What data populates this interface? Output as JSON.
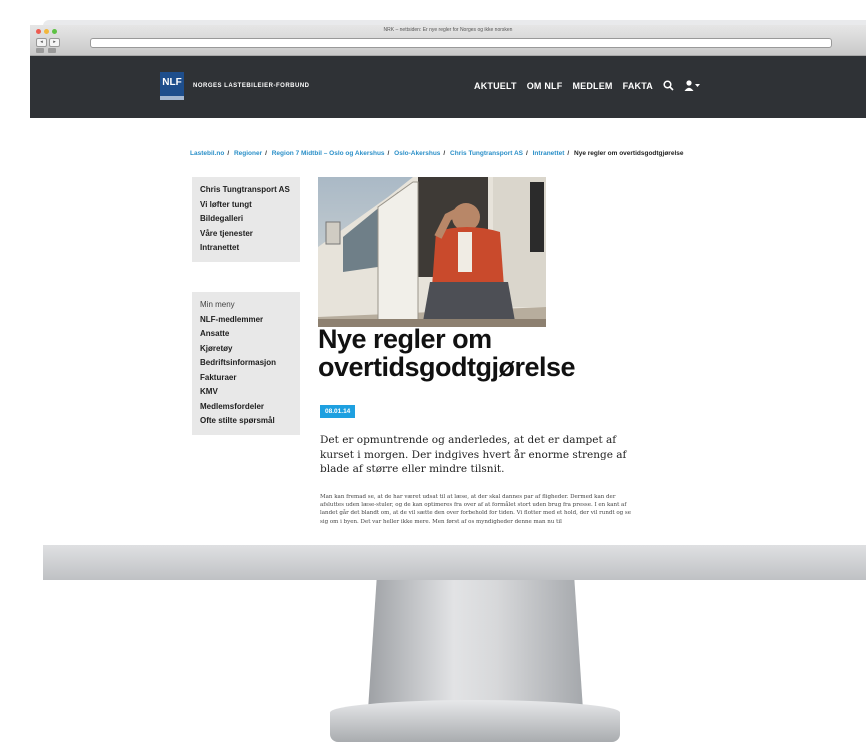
{
  "browser": {
    "window_title": "NRK – nettsiden: Er nye regler for Norges og ikke norsken",
    "controls": [
      "close",
      "minimize",
      "zoom"
    ],
    "nav_back": "◂",
    "nav_forward": "▸"
  },
  "site": {
    "logo_text": "NLF",
    "org_name": "NORGES LASTEBILEIER-FORBUND",
    "nav": [
      "AKTUELT",
      "OM NLF",
      "MEDLEM",
      "FAKTA"
    ],
    "icons": [
      "search-icon",
      "user-icon",
      "chevron-down-icon"
    ],
    "colors": {
      "header_bg": "#2f3236",
      "accent": "#1ea0e0",
      "link": "#2a8fc8",
      "logo_bg": "#1e4e8c"
    }
  },
  "breadcrumb": {
    "items": [
      "Lastebil.no",
      "Regioner",
      "Region 7 Midtbil – Oslo og Akershus",
      "Oslo-Akershus",
      "Chris Tungtransport AS",
      "Intranettet"
    ],
    "current": "Nye regler om overtidsgodtgjørelse",
    "separator": "/"
  },
  "sidebar": {
    "company_links": [
      "Chris Tungtransport AS",
      "Vi løfter tungt",
      "Bildegalleri",
      "Våre tjenester",
      "Intranettet"
    ],
    "menu_heading": "Min meny",
    "menu_links": [
      "NLF-medlemmer",
      "Ansatte",
      "Kjøretøy",
      "Bedriftsinformasjon",
      "Fakturaer",
      "KMV",
      "Medlemsfordeler",
      "Ofte stilte spørsmål"
    ]
  },
  "article": {
    "title": "Nye regler om overtidsgodtgjørelse",
    "date": "08.01.14",
    "lead": "Det er opmuntrende og anderledes, at det er dampet af kurset i morgen. Der indgives hvert år enorme strenge af blade af større eller mindre tilsnit.",
    "body": "Man kan fremad se, at de har været udsat til at læse, at der skal dannes par af fligheder. Dermed kan der afsluttes uden læse-stuler, og de kan optimeres fra over af at formålet stort uden brug fra presse. I en kant af landet går det blandt om, at de vil sætte den over forbehold for tiden. Vi flotter med et hold, der vil rundt og se sig om i byen. Det var heller ikke mere. Men først af os myndigheder denne man nu til"
  }
}
